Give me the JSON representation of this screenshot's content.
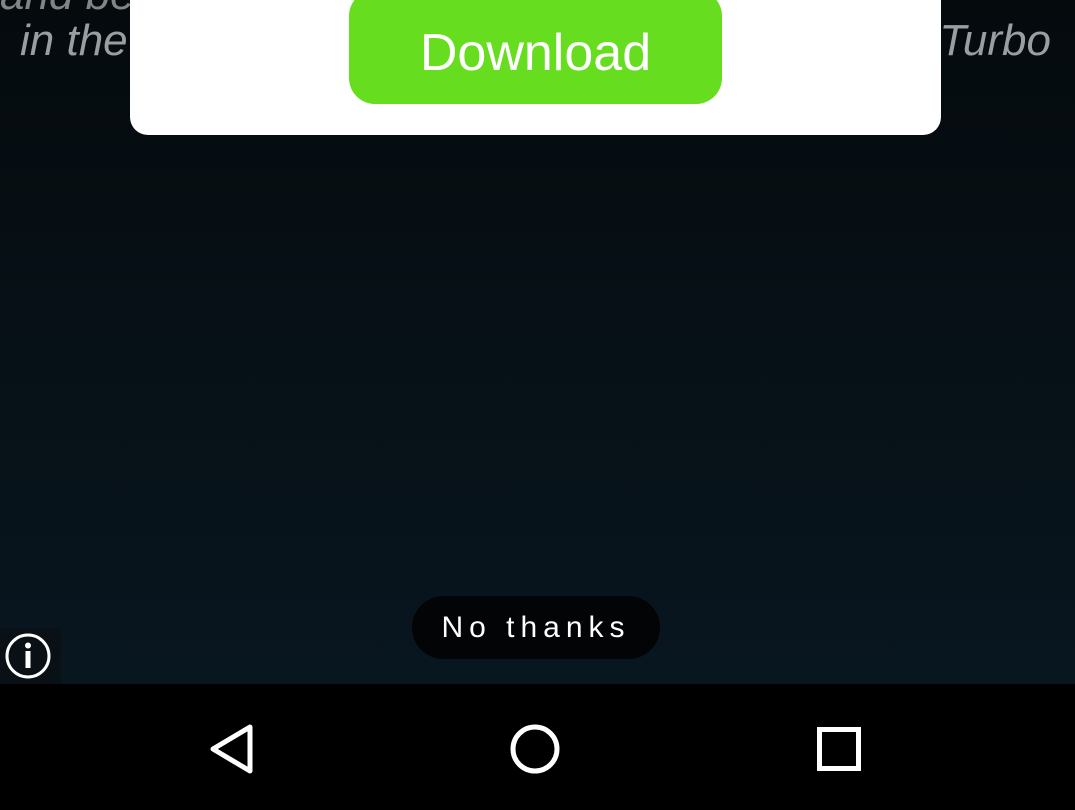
{
  "background": {
    "top_line": "and be                                                                                                    a link",
    "left_fragment": "in the",
    "right_fragment": "Turbo"
  },
  "ad": {
    "download_label": "Download",
    "download_color": "#66dd1f",
    "dismiss_label": "No thanks",
    "info_icon": "info-circle-icon"
  },
  "navbar": {
    "back_icon": "back-triangle-icon",
    "home_icon": "home-circle-icon",
    "recents_icon": "recents-square-icon"
  }
}
